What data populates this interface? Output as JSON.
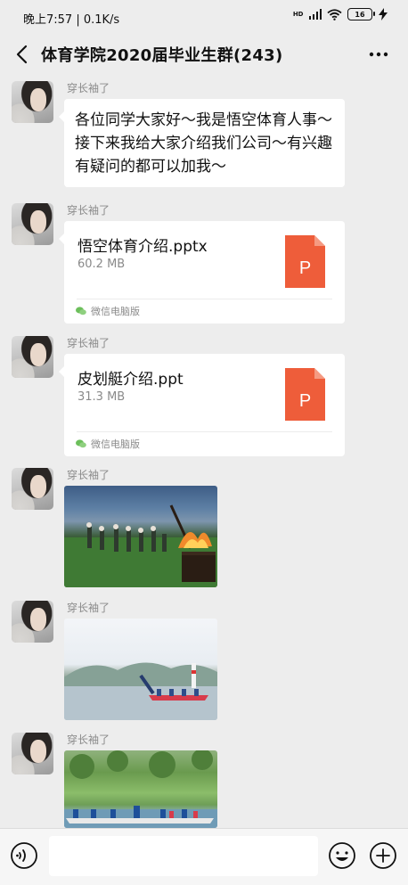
{
  "status_bar": {
    "time": "晚上7:57 | 0.1K/s",
    "hd_label": "HD",
    "battery": "16"
  },
  "header": {
    "title": "体育学院2020届毕业生群(243)"
  },
  "messages": [
    {
      "type": "text",
      "sender": "穿长袖了",
      "text": "各位同学大家好～我是悟空体育人事～接下来我给大家介绍我们公司～有兴趣有疑问的都可以加我～"
    },
    {
      "type": "file",
      "sender": "穿长袖了",
      "file_name": "悟空体育介绍.pptx",
      "file_size": "60.2 MB",
      "file_icon_letter": "P",
      "source": "微信电脑版"
    },
    {
      "type": "file",
      "sender": "穿长袖了",
      "file_name": "皮划艇介绍.ppt",
      "file_size": "31.3 MB",
      "file_icon_letter": "P",
      "source": "微信电脑版"
    },
    {
      "type": "image",
      "sender": "穿长袖了"
    },
    {
      "type": "image",
      "sender": "穿长袖了"
    },
    {
      "type": "image",
      "sender": "穿长袖了"
    }
  ],
  "icons": {
    "back": "chevron-left-icon",
    "more": "more-dots-icon",
    "voice": "voice-icon",
    "emoji": "emoji-icon",
    "plus": "plus-icon",
    "ppt": "ppt-file-icon",
    "wechat_pc": "wechat-pc-icon"
  },
  "colors": {
    "background": "#ededed",
    "bubble": "#ffffff",
    "ppt_orange": "#ee5d3a",
    "muted_text": "#8a8a8a"
  }
}
